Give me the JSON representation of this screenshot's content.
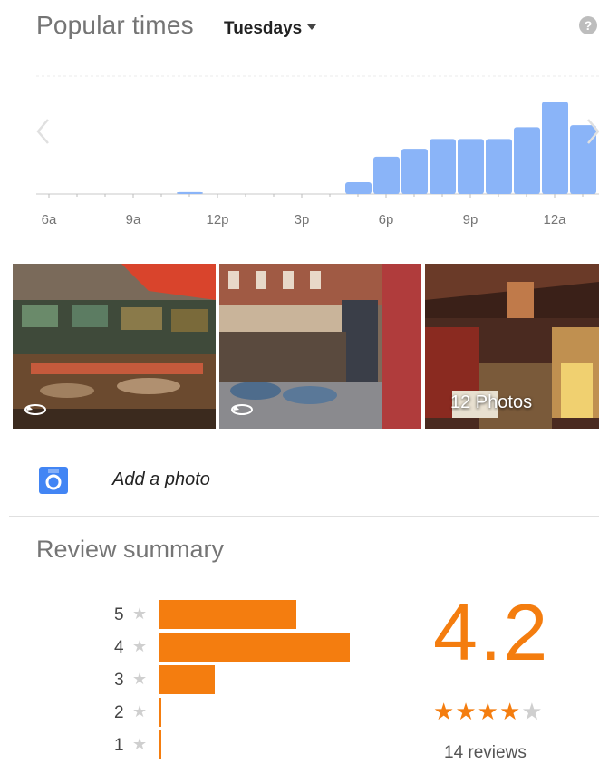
{
  "popular_times": {
    "title": "Popular times",
    "day": "Tuesdays",
    "help_symbol": "?",
    "chart_data": {
      "type": "bar",
      "title": "Popular times",
      "xlabel": "",
      "ylabel": "",
      "tick_labels": [
        "6a",
        "9a",
        "12p",
        "3p",
        "6p",
        "9p",
        "12a"
      ],
      "categories": [
        "6a",
        "7a",
        "8a",
        "9a",
        "10a",
        "11a",
        "12p",
        "1p",
        "2p",
        "3p",
        "4p",
        "5p",
        "6p",
        "7p",
        "8p",
        "9p",
        "10p",
        "11p",
        "12a",
        "1a"
      ],
      "values": [
        0,
        0,
        0,
        0,
        0,
        1,
        0,
        0,
        0,
        0,
        0,
        6,
        19,
        23,
        28,
        28,
        28,
        34,
        47,
        35
      ],
      "ylim": [
        0,
        60
      ],
      "bar_color": "#8ab4f8",
      "grid": false
    }
  },
  "photos": {
    "count_label": "12 Photos",
    "items": [
      {
        "label": "interior-photo",
        "rotatable": true
      },
      {
        "label": "terrace-photo",
        "rotatable": true
      },
      {
        "label": "dining-room-photo",
        "rotatable": false
      }
    ]
  },
  "add_photo": {
    "label": "Add a photo",
    "icon": "camera-icon",
    "icon_color": "#4285f4"
  },
  "review_summary": {
    "title": "Review summary",
    "rating": "4.2",
    "stars_filled": 4,
    "stars_total": 5,
    "reviews_link": "14 reviews",
    "accent_color": "#f47d0f",
    "chart_data": {
      "type": "bar",
      "orientation": "horizontal",
      "categories": [
        "5",
        "4",
        "3",
        "2",
        "1"
      ],
      "values": [
        0.72,
        1.0,
        0.29,
        0.01,
        0.01
      ],
      "xlim": [
        0,
        1
      ]
    }
  }
}
